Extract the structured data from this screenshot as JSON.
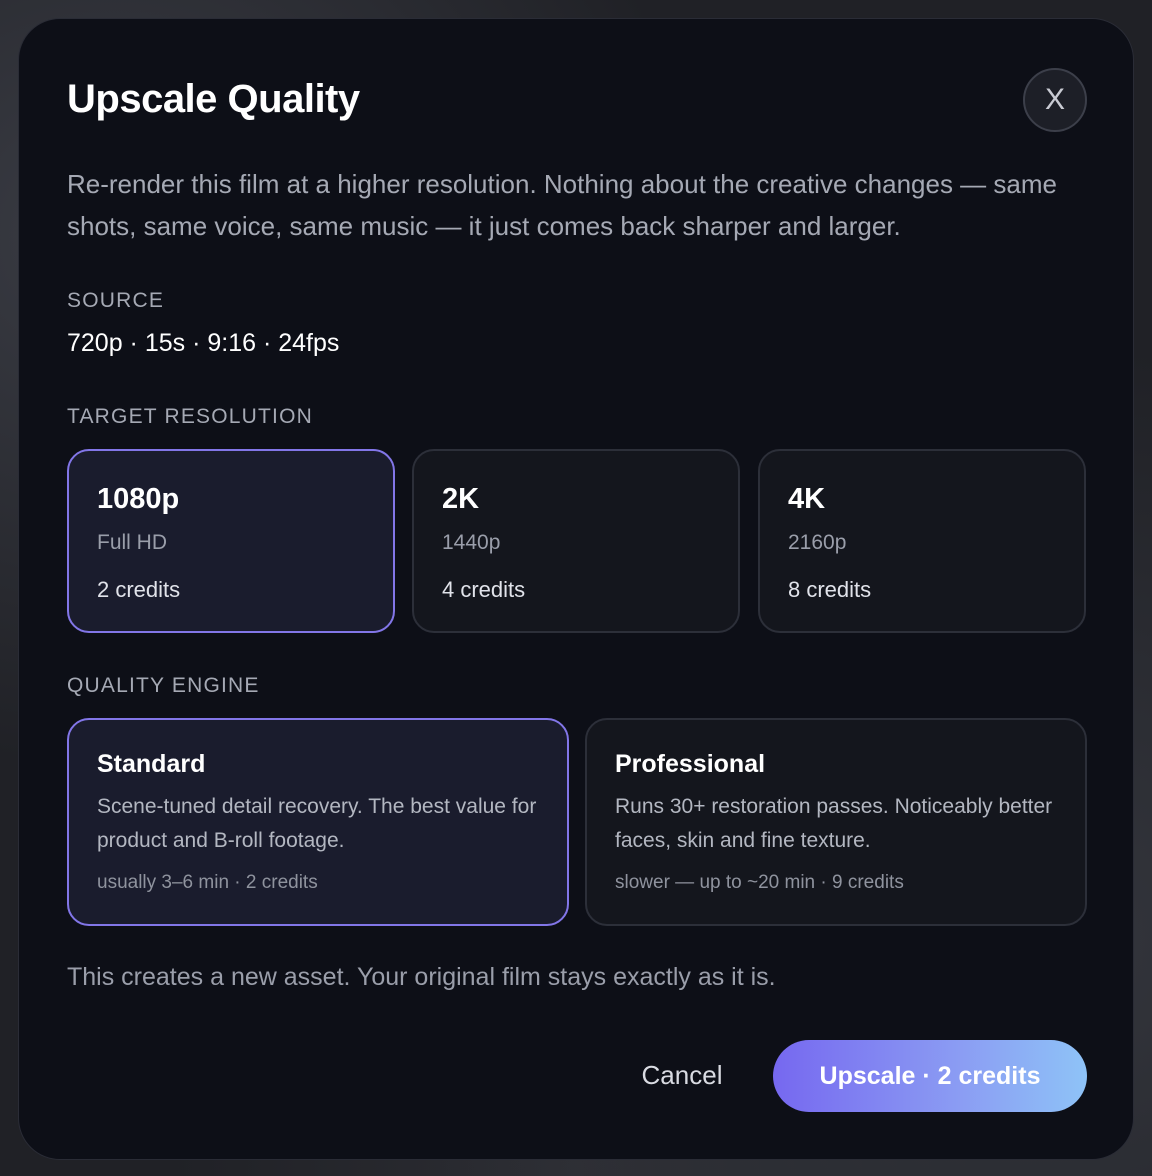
{
  "dialog": {
    "title": "Upscale Quality",
    "close_label": "X",
    "description": "Re-render this film at a higher resolution. Nothing about the creative changes — same shots, same voice, same music — it just comes back sharper and larger."
  },
  "source": {
    "label": "SOURCE",
    "value": "720p · 15s · 9:16 · 24fps"
  },
  "target_resolution": {
    "label": "TARGET RESOLUTION",
    "options": [
      {
        "name": "1080p",
        "subtitle": "Full HD",
        "cost": "2 credits",
        "selected": true
      },
      {
        "name": "2K",
        "subtitle": "1440p",
        "cost": "4 credits",
        "selected": false
      },
      {
        "name": "4K",
        "subtitle": "2160p",
        "cost": "8 credits",
        "selected": false
      }
    ]
  },
  "quality_engine": {
    "label": "QUALITY ENGINE",
    "options": [
      {
        "name": "Standard",
        "description": "Scene-tuned detail recovery. The best value for product and B-roll footage.",
        "meta": "usually 3–6 min · 2 credits",
        "selected": true
      },
      {
        "name": "Professional",
        "description": "Runs 30+ restoration passes. Noticeably better faces, skin and fine texture.",
        "meta": "slower — up to ~20 min · 9 credits",
        "selected": false
      }
    ]
  },
  "footnote": "This creates a new asset. Your original film stays exactly as it is.",
  "actions": {
    "cancel_label": "Cancel",
    "confirm_label": "Upscale · 2 credits"
  },
  "colors": {
    "accent": "#8276e8",
    "background": "#0d0f17",
    "button_gradient_start": "#7668f0",
    "button_gradient_end": "#8ec3f7"
  }
}
